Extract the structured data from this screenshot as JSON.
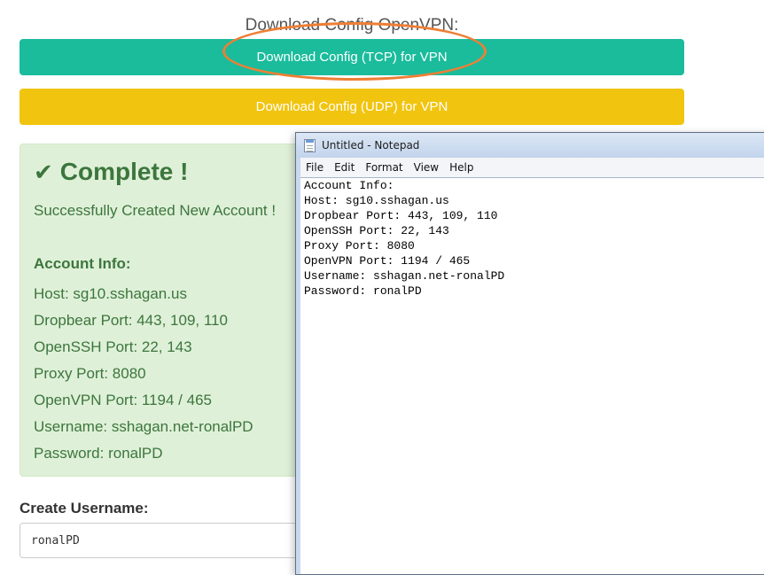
{
  "download": {
    "heading": "Download Config OpenVPN:",
    "tcp_button": "Download Config (TCP) for VPN",
    "udp_button": "Download Config (UDP) for VPN"
  },
  "alert": {
    "check_icon": "checkmark-icon",
    "title": "Complete !",
    "subtitle": "Successfully Created New Account !",
    "info_heading": "Account Info:",
    "lines": [
      "Host: sg10.sshagan.us",
      "Dropbear Port: 443, 109, 110",
      "OpenSSH Port: 22, 143",
      "Proxy Port: 8080",
      "OpenVPN Port: 1194 / 465",
      "Username: sshagan.net-ronalPD",
      "Password: ronalPD"
    ]
  },
  "form": {
    "username_label": "Create Username:",
    "username_value": "ronalPD"
  },
  "notepad": {
    "title": "Untitled - Notepad",
    "menu": [
      "File",
      "Edit",
      "Format",
      "View",
      "Help"
    ],
    "content_lines": [
      "Account Info:",
      "Host: sg10.sshagan.us",
      "Dropbear Port: 443, 109, 110",
      "OpenSSH Port: 22, 143",
      "Proxy Port: 8080",
      "OpenVPN Port: 1194 / 465",
      "Username: sshagan.net-ronalPD",
      "Password: ronalPD"
    ]
  },
  "colors": {
    "tcp_button": "#1abc9c",
    "udp_button": "#f1c40f",
    "highlight": "#ee7f35",
    "success_bg": "#dff0d8",
    "success_text": "#3c763d"
  }
}
